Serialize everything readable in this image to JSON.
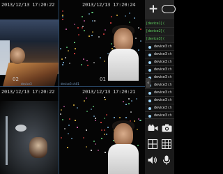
{
  "cells": [
    {
      "timestamp": "2013/12/13  17:20:22",
      "channel": "02",
      "label": "device3"
    },
    {
      "timestamp": "2013/12/13  17:20:24",
      "channel": "01",
      "label": "device3 ch01"
    },
    {
      "timestamp": "2013/12/13  17:20:22",
      "channel": "",
      "label": ""
    },
    {
      "timestamp": "2013/12/13  17:20:21",
      "channel": "",
      "label": ""
    }
  ],
  "device_list": [
    {
      "kind": "group",
      "label": "[device1] ("
    },
    {
      "kind": "group",
      "label": "[device2] ("
    },
    {
      "kind": "group",
      "label": "[device3] ("
    },
    {
      "kind": "item",
      "name": "device3",
      "ch": "ch"
    },
    {
      "kind": "item",
      "name": "device3",
      "ch": "ch"
    },
    {
      "kind": "item",
      "name": "device3",
      "ch": "ch"
    },
    {
      "kind": "item",
      "name": "device3",
      "ch": "ch"
    },
    {
      "kind": "item",
      "name": "device3",
      "ch": "ch"
    },
    {
      "kind": "item",
      "name": "device3",
      "ch": "ch"
    },
    {
      "kind": "item",
      "name": "device3",
      "ch": "ch"
    },
    {
      "kind": "item",
      "name": "device3",
      "ch": "ch"
    },
    {
      "kind": "item",
      "name": "device3",
      "ch": "ch"
    },
    {
      "kind": "item",
      "name": "device3",
      "ch": "ch"
    }
  ],
  "icons": {
    "add": "plus-icon",
    "toggle": "pill-toggle-icon",
    "collapse": "chevron-left-icon",
    "record": "video-camera-icon",
    "snapshot": "camera-icon",
    "layout_4": "grid-4-icon",
    "layout_9": "grid-9-icon",
    "audio": "speaker-icon",
    "talk": "microphone-icon"
  },
  "colors": {
    "group_text": "#5ed05e",
    "item_bullet": "#9fd8ff",
    "divider": "#2a4a6a"
  },
  "collapse_glyph": "‹"
}
